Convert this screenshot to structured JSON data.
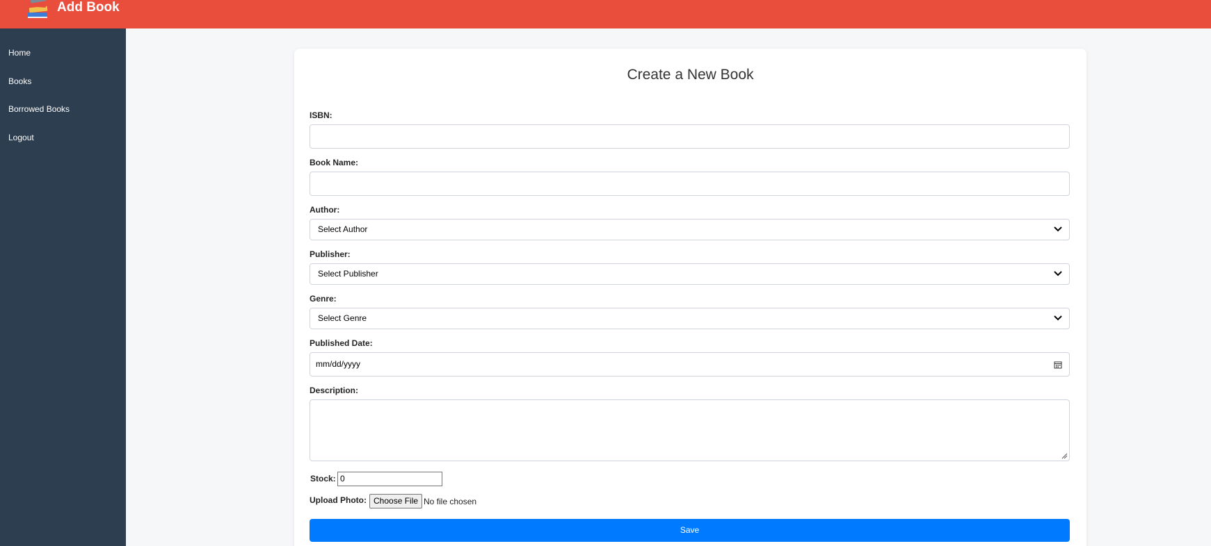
{
  "header": {
    "title": "Add Book",
    "logo_icon": "books-stack-icon",
    "bg_color": "#e94e3d"
  },
  "sidebar": {
    "bg_color": "#2c3e50",
    "items": [
      {
        "label": "Home"
      },
      {
        "label": "Books"
      },
      {
        "label": "Borrowed Books"
      },
      {
        "label": "Logout"
      }
    ]
  },
  "form": {
    "title": "Create a New Book",
    "isbn": {
      "label": "ISBN:",
      "value": ""
    },
    "book_name": {
      "label": "Book Name:",
      "value": ""
    },
    "author": {
      "label": "Author:",
      "selected": "Select Author"
    },
    "publisher": {
      "label": "Publisher:",
      "selected": "Select Publisher"
    },
    "genre": {
      "label": "Genre:",
      "selected": "Select Genre"
    },
    "published_date": {
      "label": "Published Date:",
      "placeholder": "mm/dd/yyyy"
    },
    "description": {
      "label": "Description:",
      "value": ""
    },
    "stock": {
      "label": "Stock:",
      "value": "0"
    },
    "photo": {
      "label": "Upload Photo:",
      "button": "Choose File",
      "status": "No file chosen"
    },
    "save_label": "Save",
    "save_color": "#007bff"
  }
}
